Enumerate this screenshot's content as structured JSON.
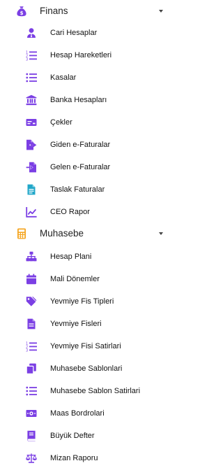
{
  "colors": {
    "accent": "#7b3fe4",
    "finance_icon": "#7b3fe4",
    "accounting_icon": "#f5a623",
    "draft_icon": "#21a7c9"
  },
  "sections": [
    {
      "label": "Finans",
      "icon": "money-bag-icon",
      "items": [
        {
          "label": "Cari Hesaplar",
          "icon": "user-tie-icon"
        },
        {
          "label": "Hesap Hareketleri",
          "icon": "numbered-list-icon"
        },
        {
          "label": "Kasalar",
          "icon": "list-icon"
        },
        {
          "label": "Banka Hesapları",
          "icon": "bank-icon"
        },
        {
          "label": "Çekler",
          "icon": "check-card-icon"
        },
        {
          "label": "Giden e-Faturalar",
          "icon": "file-export-icon"
        },
        {
          "label": "Gelen e-Faturalar",
          "icon": "file-import-icon"
        },
        {
          "label": "Taslak Faturalar",
          "icon": "document-icon"
        },
        {
          "label": "CEO Rapor",
          "icon": "line-chart-icon"
        }
      ]
    },
    {
      "label": "Muhasebe",
      "icon": "calculator-icon",
      "items": [
        {
          "label": "Hesap Plani",
          "icon": "sitemap-icon"
        },
        {
          "label": "Mali Dönemler",
          "icon": "calendar-icon"
        },
        {
          "label": "Yevmiye Fis Tipleri",
          "icon": "tags-icon"
        },
        {
          "label": "Yevmiye Fisleri",
          "icon": "file-text-icon"
        },
        {
          "label": "Yevmiye Fisi Satirlari",
          "icon": "numbered-list-icon"
        },
        {
          "label": "Muhasebe Sablonlari",
          "icon": "copy-icon"
        },
        {
          "label": "Muhasebe Sablon Satirlari",
          "icon": "list-icon"
        },
        {
          "label": "Maas Bordrolari",
          "icon": "money-bill-icon"
        },
        {
          "label": "Büyük Defter",
          "icon": "book-icon"
        },
        {
          "label": "Mizan Raporu",
          "icon": "balance-scale-icon"
        }
      ]
    }
  ]
}
